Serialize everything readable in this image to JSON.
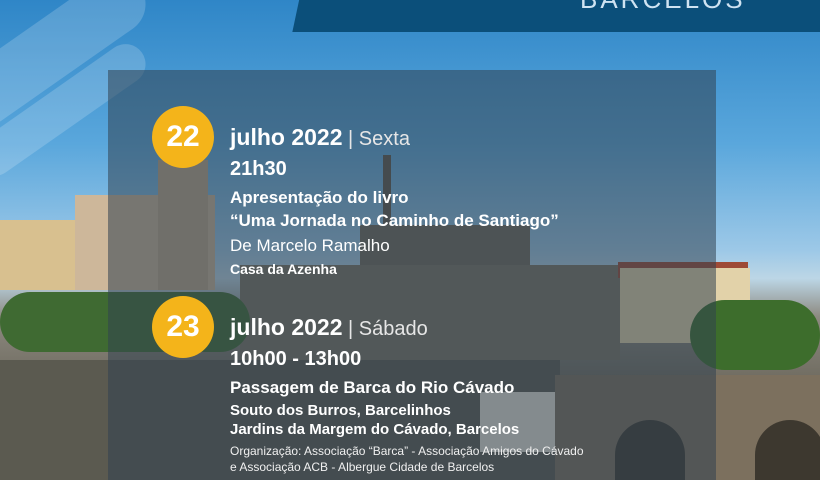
{
  "header": {
    "brand_text": "BARCELOS"
  },
  "events": [
    {
      "day": "22",
      "month_year": "julho 2022",
      "weekday": "Sexta",
      "time": "21h30",
      "title_line1": "Apresentação do livro",
      "title_line2": "“Uma Jornada no Caminho de Santiago”",
      "author": "De Marcelo Ramalho",
      "venue": "Casa da Azenha"
    },
    {
      "day": "23",
      "month_year": "julho 2022",
      "weekday": "Sábado",
      "time": "10h00 - 13h00",
      "title": "Passagem de Barca do Rio Cávado",
      "location_line1": "Souto dos Burros, Barcelinhos",
      "location_line2": "Jardins da Margem do Cávado, Barcelos",
      "organizer_line1": "Organização: Associação “Barca” - Associação Amigos do Cávado",
      "organizer_line2": "e Associação ACB - Albergue Cidade de Barcelos"
    }
  ],
  "colors": {
    "badge": "#f4b41a",
    "banner": "#0b4f7a",
    "text": "#ffffff"
  }
}
